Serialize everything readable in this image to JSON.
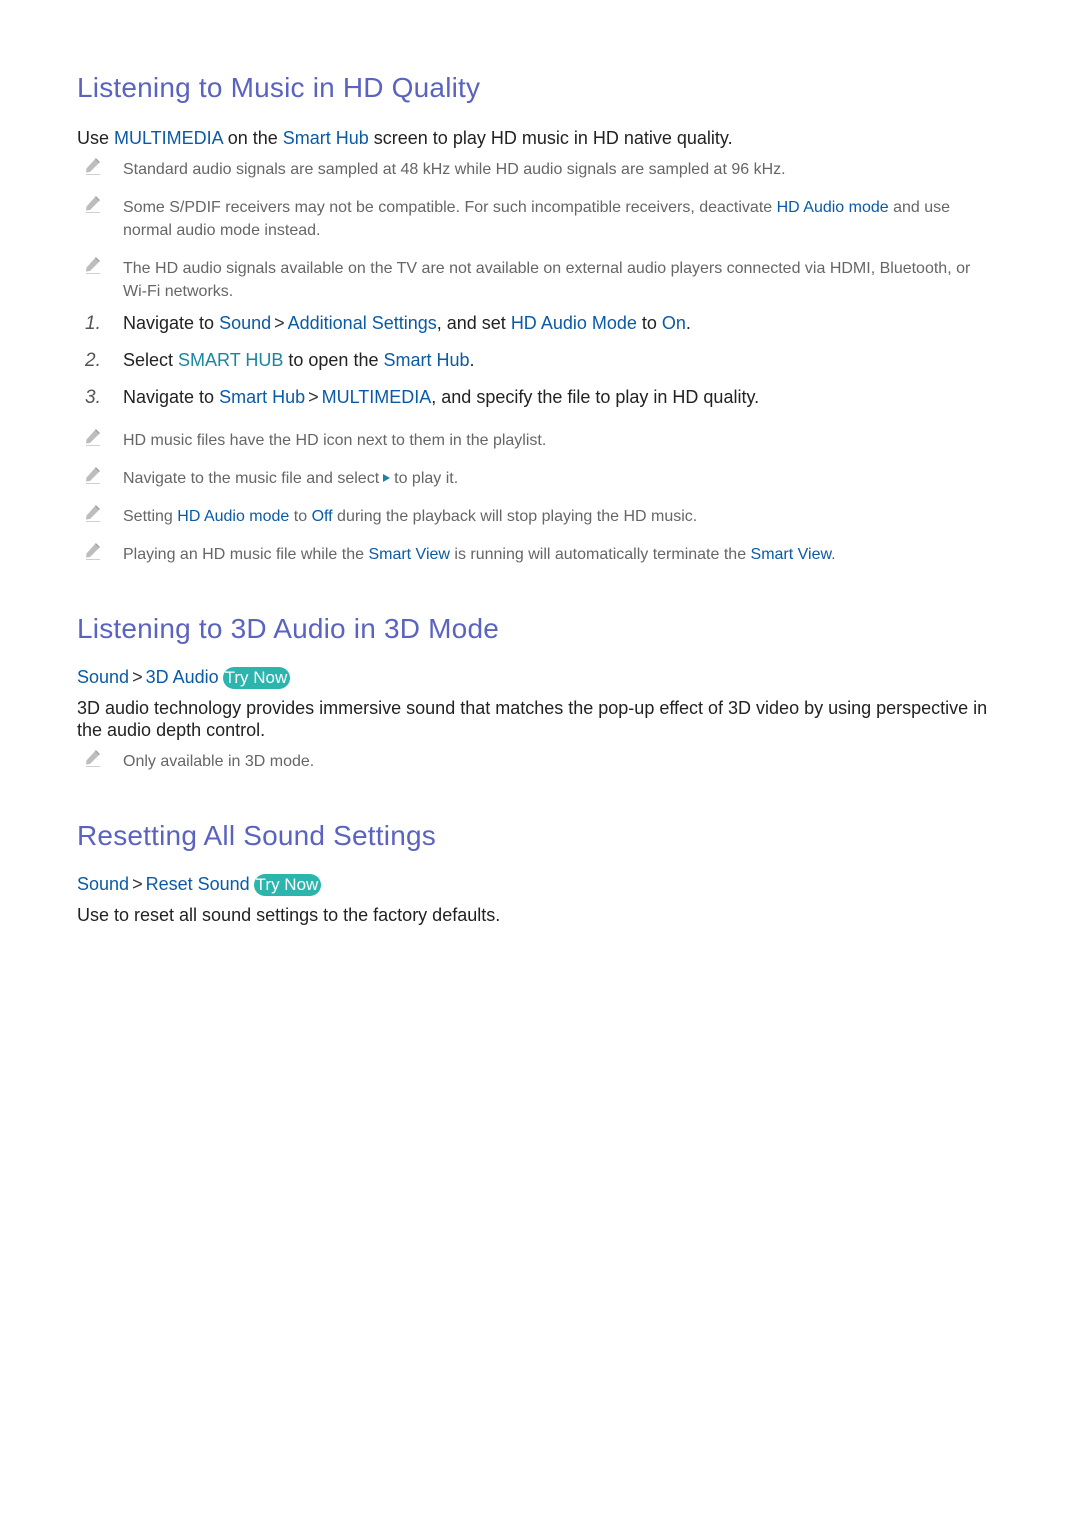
{
  "colors": {
    "heading": "#5b63c0",
    "keyword": "#0b5aa6",
    "teal_keyword": "#1a86a0",
    "try_now_bg": "#2bb5ad",
    "note_text": "#666666",
    "body_text": "#222222"
  },
  "section1": {
    "title": "Listening to Music in HD Quality",
    "intro": {
      "p1": "Use ",
      "k1": "MULTIMEDIA",
      "p2": " on the ",
      "k2": "Smart Hub",
      "p3": " screen to play HD music in HD native quality."
    },
    "notes_top": [
      {
        "icon": "pencil-icon",
        "text": "Standard audio signals are sampled at 48 kHz while HD audio signals are sampled at 96 kHz."
      },
      {
        "icon": "pencil-icon",
        "p1": "Some S/PDIF receivers may not be compatible. For such incompatible receivers, deactivate ",
        "k1": "HD Audio mode",
        "p2": " and use normal audio mode instead."
      },
      {
        "icon": "pencil-icon",
        "text": "The HD audio signals available on the TV are not available on external audio players connected via HDMI, Bluetooth, or Wi-Fi networks."
      }
    ],
    "steps": [
      {
        "num": "1.",
        "p1": "Navigate to ",
        "k1": "Sound",
        "sep": ">",
        "k2": "Additional Settings",
        "p2": ", and set ",
        "k3": "HD Audio Mode",
        "p3": " to ",
        "k4": "On",
        "p4": "."
      },
      {
        "num": "2.",
        "p1": "Select ",
        "k1": "SMART HUB",
        "p2": " to open the ",
        "k2": "Smart Hub",
        "p3": "."
      },
      {
        "num": "3.",
        "p1": "Navigate to ",
        "k1": "Smart Hub",
        "sep": ">",
        "k2": "MULTIMEDIA",
        "p2": ", and specify the file to play in HD quality."
      }
    ],
    "notes_bottom": [
      {
        "icon": "pencil-icon",
        "text": "HD music files have the HD icon next to them in the playlist."
      },
      {
        "icon": "pencil-icon",
        "p1": "Navigate to the music file and select",
        "play_icon": "play-icon",
        "p2": "to play it."
      },
      {
        "icon": "pencil-icon",
        "p1": "Setting ",
        "k1": "HD Audio mode",
        "p2": " to ",
        "k2": "Off",
        "p3": " during the playback will stop playing the HD music."
      },
      {
        "icon": "pencil-icon",
        "p1": "Playing an HD music file while the ",
        "k1": "Smart View",
        "p2": " is running will automatically terminate the ",
        "k2": "Smart View",
        "p3": "."
      }
    ]
  },
  "section2": {
    "title": "Listening to 3D Audio in 3D Mode",
    "path": {
      "k1": "Sound",
      "sep": ">",
      "k2": "3D Audio",
      "try_now": "Try Now"
    },
    "body": "3D audio technology provides immersive sound that matches the pop-up effect of 3D video by using perspective in the audio depth control.",
    "note": {
      "icon": "pencil-icon",
      "text": "Only available in 3D mode."
    }
  },
  "section3": {
    "title": "Resetting All Sound Settings",
    "path": {
      "k1": "Sound",
      "sep": ">",
      "k2": "Reset Sound",
      "try_now": "Try Now"
    },
    "body": "Use to reset all sound settings to the factory defaults."
  }
}
